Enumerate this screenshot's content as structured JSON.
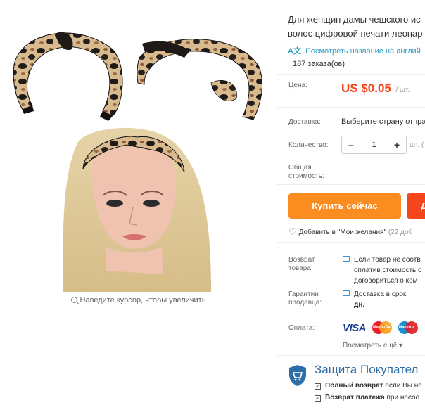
{
  "product": {
    "title_line1": "Для женщин дамы чешского ис",
    "title_line2": "волос цифровой печати леопар",
    "translate_label": "Посмотреть название на англий",
    "translate_icon": "translate-icon",
    "orders": "187 заказа(ов)",
    "zoom_hint": "Наведите курсор, чтобы увеличить"
  },
  "price": {
    "label": "Цена:",
    "value": "US $0.05",
    "unit": "/ шт."
  },
  "shipping": {
    "label": "Доставка:",
    "value": "Выберите страну отпра"
  },
  "quantity": {
    "label": "Количество:",
    "minus": "−",
    "value": "1",
    "plus": "+",
    "unit": "шт. ("
  },
  "total": {
    "label_line1": "Общая",
    "label_line2": "стоимость:"
  },
  "actions": {
    "buy_now": "Купить сейчас",
    "add_to_cart": "Д",
    "wishlist": "Добавить в \"Мои желания\"",
    "wishlist_count": "(22 доб"
  },
  "return": {
    "label_line1": "Возврат",
    "label_line2": "товара",
    "line1": "Если товар не соотв",
    "line2": "оплатив стоимость о",
    "line3": "договориться о ком"
  },
  "guarantee": {
    "label_line1": "Гарантии",
    "label_line2": "продавца:",
    "line1": "Доставка в срок",
    "line2": "дн."
  },
  "payment": {
    "label": "Оплата:",
    "visa": "VISA",
    "mastercard": "MasterCard",
    "maestro": "Maestro",
    "more": "Посмотреть ещё"
  },
  "protection": {
    "title": "Защита Покупател",
    "line1_bold": "Полный возврат",
    "line1_rest": " если Вы не",
    "line2_bold": "Возврат платежа",
    "line2_rest": " при несоо"
  },
  "colors": {
    "price_red": "#f5451d",
    "buy_orange": "#fb8c20",
    "link_blue": "#2e9cc3",
    "protect_blue": "#2e6ea8"
  }
}
